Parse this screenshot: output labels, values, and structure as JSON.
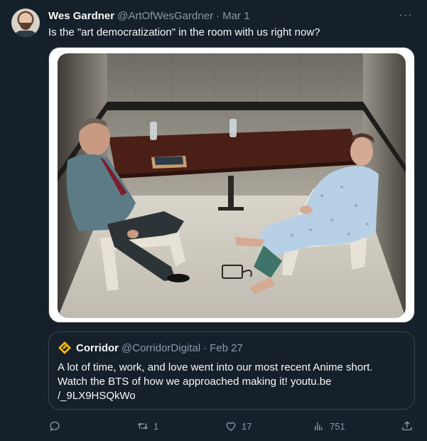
{
  "tweet": {
    "author_name": "Wes Gardner",
    "author_handle": "@ArtOfWesGardner",
    "separator": "·",
    "date": "Mar 1",
    "more_label": "···",
    "text": "Is the \"art democratization\" in the room with us right now?"
  },
  "quote": {
    "author_name": "Corridor",
    "author_handle": "@CorridorDigital",
    "separator": "·",
    "date": "Feb 27",
    "text": "A lot of time, work, and love went into our most recent Anime short. Watch the BTS of how we approached making it! youtu.be /_9LX9HSQkWo"
  },
  "actions": {
    "reply_count": "",
    "retweet_count": "1",
    "like_count": "17",
    "views_count": "751"
  },
  "colors": {
    "background": "#15202b",
    "text_primary": "#f7f9f9",
    "text_secondary": "#8b98a5",
    "border": "#38444d",
    "corridor_logo": "#f5b400"
  },
  "icons": [
    "more-icon",
    "corridor-logo-icon",
    "reply-icon",
    "retweet-icon",
    "like-icon",
    "views-icon",
    "share-icon"
  ]
}
